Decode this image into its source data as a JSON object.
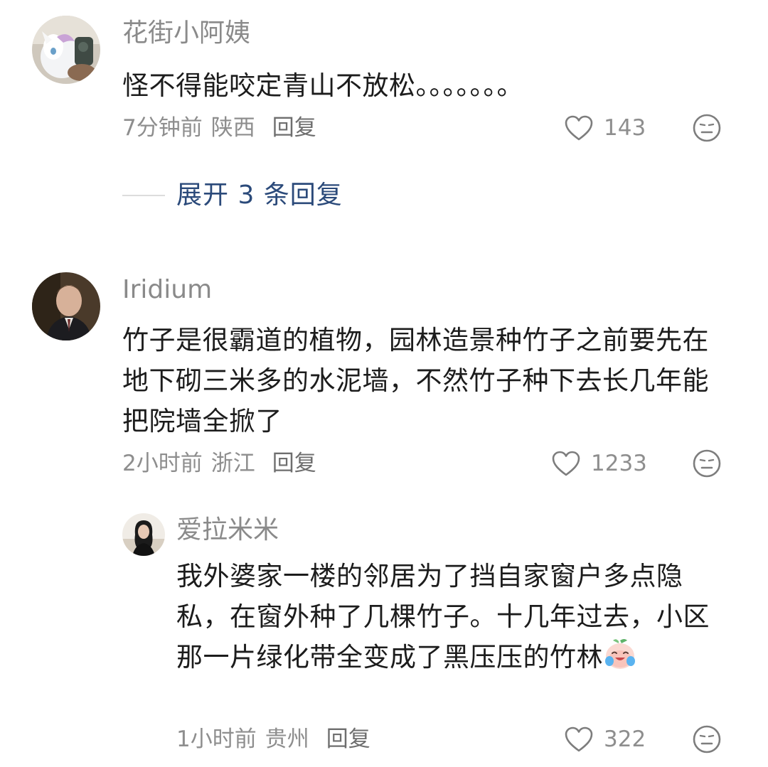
{
  "comments": [
    {
      "username": "花街小阿姨",
      "text": "怪不得能咬定青山不放松。。。。。。。",
      "time": "7分钟前",
      "location": "陕西",
      "reply_label": "回复",
      "likes": "143",
      "expand_label": "展开 3 条回复"
    },
    {
      "username": "Iridium",
      "text": "竹子是很霸道的植物，园林造景种竹子之前要先在地下砌三米多的水泥墙，不然竹子种下去长几年能把院墙全掀了",
      "time": "2小时前",
      "location": "浙江",
      "reply_label": "回复",
      "likes": "1233"
    },
    {
      "username": "爱拉米米",
      "text": "我外婆家一楼的邻居为了挡自家窗户多点隐私，在窗外种了几棵竹子。十几年过去，小区那一片绿化带全变成了黑压压的竹林",
      "time": "1小时前",
      "location": "贵州",
      "reply_label": "回复",
      "likes": "322"
    }
  ],
  "icons": {
    "like": "heart-outline-icon",
    "dislike": "neutral-face-icon",
    "emoji": "crying-laughing-peach-emoji"
  },
  "colors": {
    "expand_link": "#2b4a7a",
    "meta_text": "#8e8e8e",
    "username": "#8a8a8a"
  }
}
